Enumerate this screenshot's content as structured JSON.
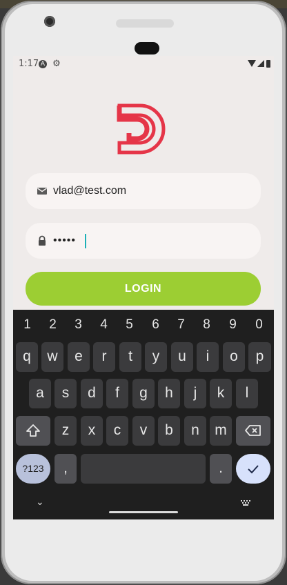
{
  "status_bar": {
    "time": "1:17",
    "icons": [
      "accessibility-a-icon",
      "gear-icon",
      "wifi-icon",
      "signal-icon",
      "battery-icon"
    ]
  },
  "login": {
    "logo_icon": "brand-d-logo-icon",
    "email": {
      "value": "vlad@test.com",
      "icon": "mail-icon"
    },
    "password": {
      "value": "•••••",
      "icon": "lock-icon"
    },
    "button_label": "LOGIN"
  },
  "keyboard": {
    "numbers": [
      "1",
      "2",
      "3",
      "4",
      "5",
      "6",
      "7",
      "8",
      "9",
      "0"
    ],
    "row1": [
      "q",
      "w",
      "e",
      "r",
      "t",
      "y",
      "u",
      "i",
      "o",
      "p"
    ],
    "row2": [
      "a",
      "s",
      "d",
      "f",
      "g",
      "h",
      "j",
      "k",
      "l"
    ],
    "row3": [
      "z",
      "x",
      "c",
      "v",
      "b",
      "n",
      "m"
    ],
    "symbols_label": "?123",
    "comma": ",",
    "period": ".",
    "icons": [
      "shift-icon",
      "backspace-icon",
      "checkmark-icon",
      "chevron-down-icon",
      "keyboard-icon"
    ]
  },
  "colors": {
    "accent": "#9cce33",
    "logo": "#e53548",
    "keyboard_bg": "#1f1f1f",
    "field_bg": "#f8f4f3",
    "screen_bg": "#efebea"
  }
}
